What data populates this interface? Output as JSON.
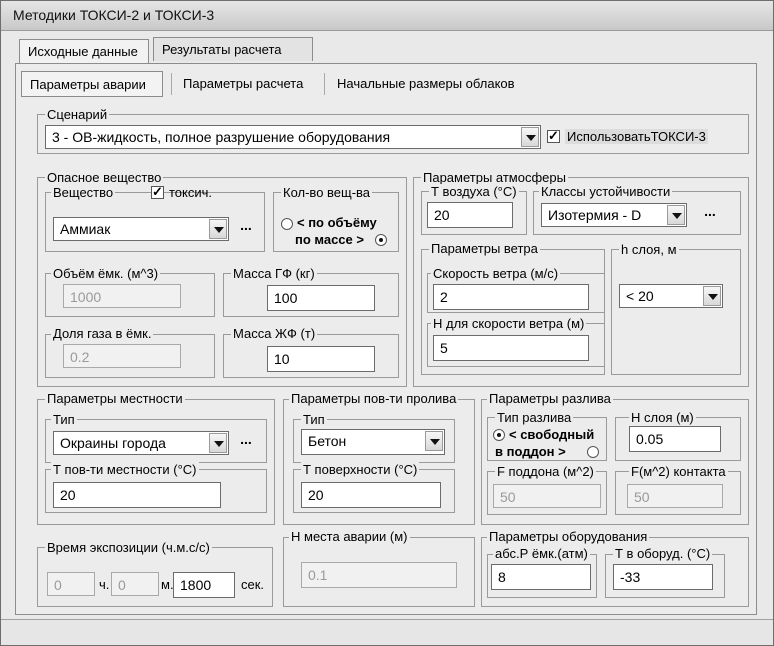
{
  "window": {
    "title": "Методики ТОКСИ-2 и ТОКСИ-3"
  },
  "tabs_main": [
    "Исходные данные",
    "Результаты расчета"
  ],
  "tabs_sub": [
    "Параметры аварии",
    "Параметры расчета",
    "Начальные размеры облаков"
  ],
  "scenario": {
    "label": "Сценарий",
    "value": "3 - ОВ-жидкость, полное разрушение оборудования",
    "use_toksi3_label": "ИспользоватьТОКСИ-3",
    "use_toksi3_checked": true
  },
  "hazard": {
    "label": "Опасное вещество",
    "substance_label": "Вещество",
    "toxic_label": "токсич.",
    "toxic_checked": true,
    "substance_value": "Аммиак",
    "more_label": "...",
    "amount_label": "Кол-во вещ-ва",
    "by_volume_label": "< по объёму",
    "by_mass_label": "по массе >",
    "volume_label": "Объём ёмк. (м^3)",
    "volume_value": "1000",
    "mass_gas_label": "Масса ГФ (кг)",
    "mass_gas_value": "100",
    "gas_share_label": "Доля газа в ёмк.",
    "gas_share_value": "0.2",
    "mass_liquid_label": "Масса ЖФ (т)",
    "mass_liquid_value": "10"
  },
  "atmosphere": {
    "label": "Параметры атмосферы",
    "air_temp_label": "Т воздуха (°С)",
    "air_temp_value": "20",
    "stability_label": "Классы устойчивости",
    "stability_value": "Изотермия - D",
    "more_label": "...",
    "wind_label": "Параметры ветра",
    "wind_speed_label": "Скорость ветра (м/с)",
    "wind_speed_value": "2",
    "wind_height_label": "Н для скорости ветра (м)",
    "wind_height_value": "5",
    "layer_label": "h слоя, м",
    "layer_value": "< 20"
  },
  "terrain": {
    "label": "Параметры местности",
    "type_label": "Тип",
    "type_value": "Окраины города",
    "more_label": "...",
    "surface_temp_label": "Т пов-ти местности (°С)",
    "surface_temp_value": "20"
  },
  "spill_surface": {
    "label": "Параметры пов-ти пролива",
    "type_label": "Тип",
    "type_value": "Бетон",
    "temp_label": "Т поверхности (°С)",
    "temp_value": "20"
  },
  "spill": {
    "label": "Параметры разлива",
    "type_label": "Тип разлива",
    "free_label": "< свободный",
    "tray_label": "в поддон >",
    "layer_h_label": "Н слоя (м)",
    "layer_h_value": "0.05",
    "tray_area_label": "F поддона (м^2)",
    "tray_area_value": "50",
    "contact_area_label": "F(м^2) контакта",
    "contact_area_value": "50"
  },
  "exposure": {
    "label": "Время экспозиции (ч.м.с/с)",
    "hours_value": "0",
    "hours_unit": "ч.",
    "min_value": "0",
    "min_unit": "м.",
    "sec_value": "1800",
    "sec_unit": "сек."
  },
  "accident_height": {
    "label": "Н места аварии (м)",
    "value": "0.1"
  },
  "equipment": {
    "label": "Параметры оборудования",
    "pressure_label": "абс.Р ёмк.(атм)",
    "pressure_value": "8",
    "temp_label": "Т в оборуд. (°С)",
    "temp_value": "-33"
  }
}
